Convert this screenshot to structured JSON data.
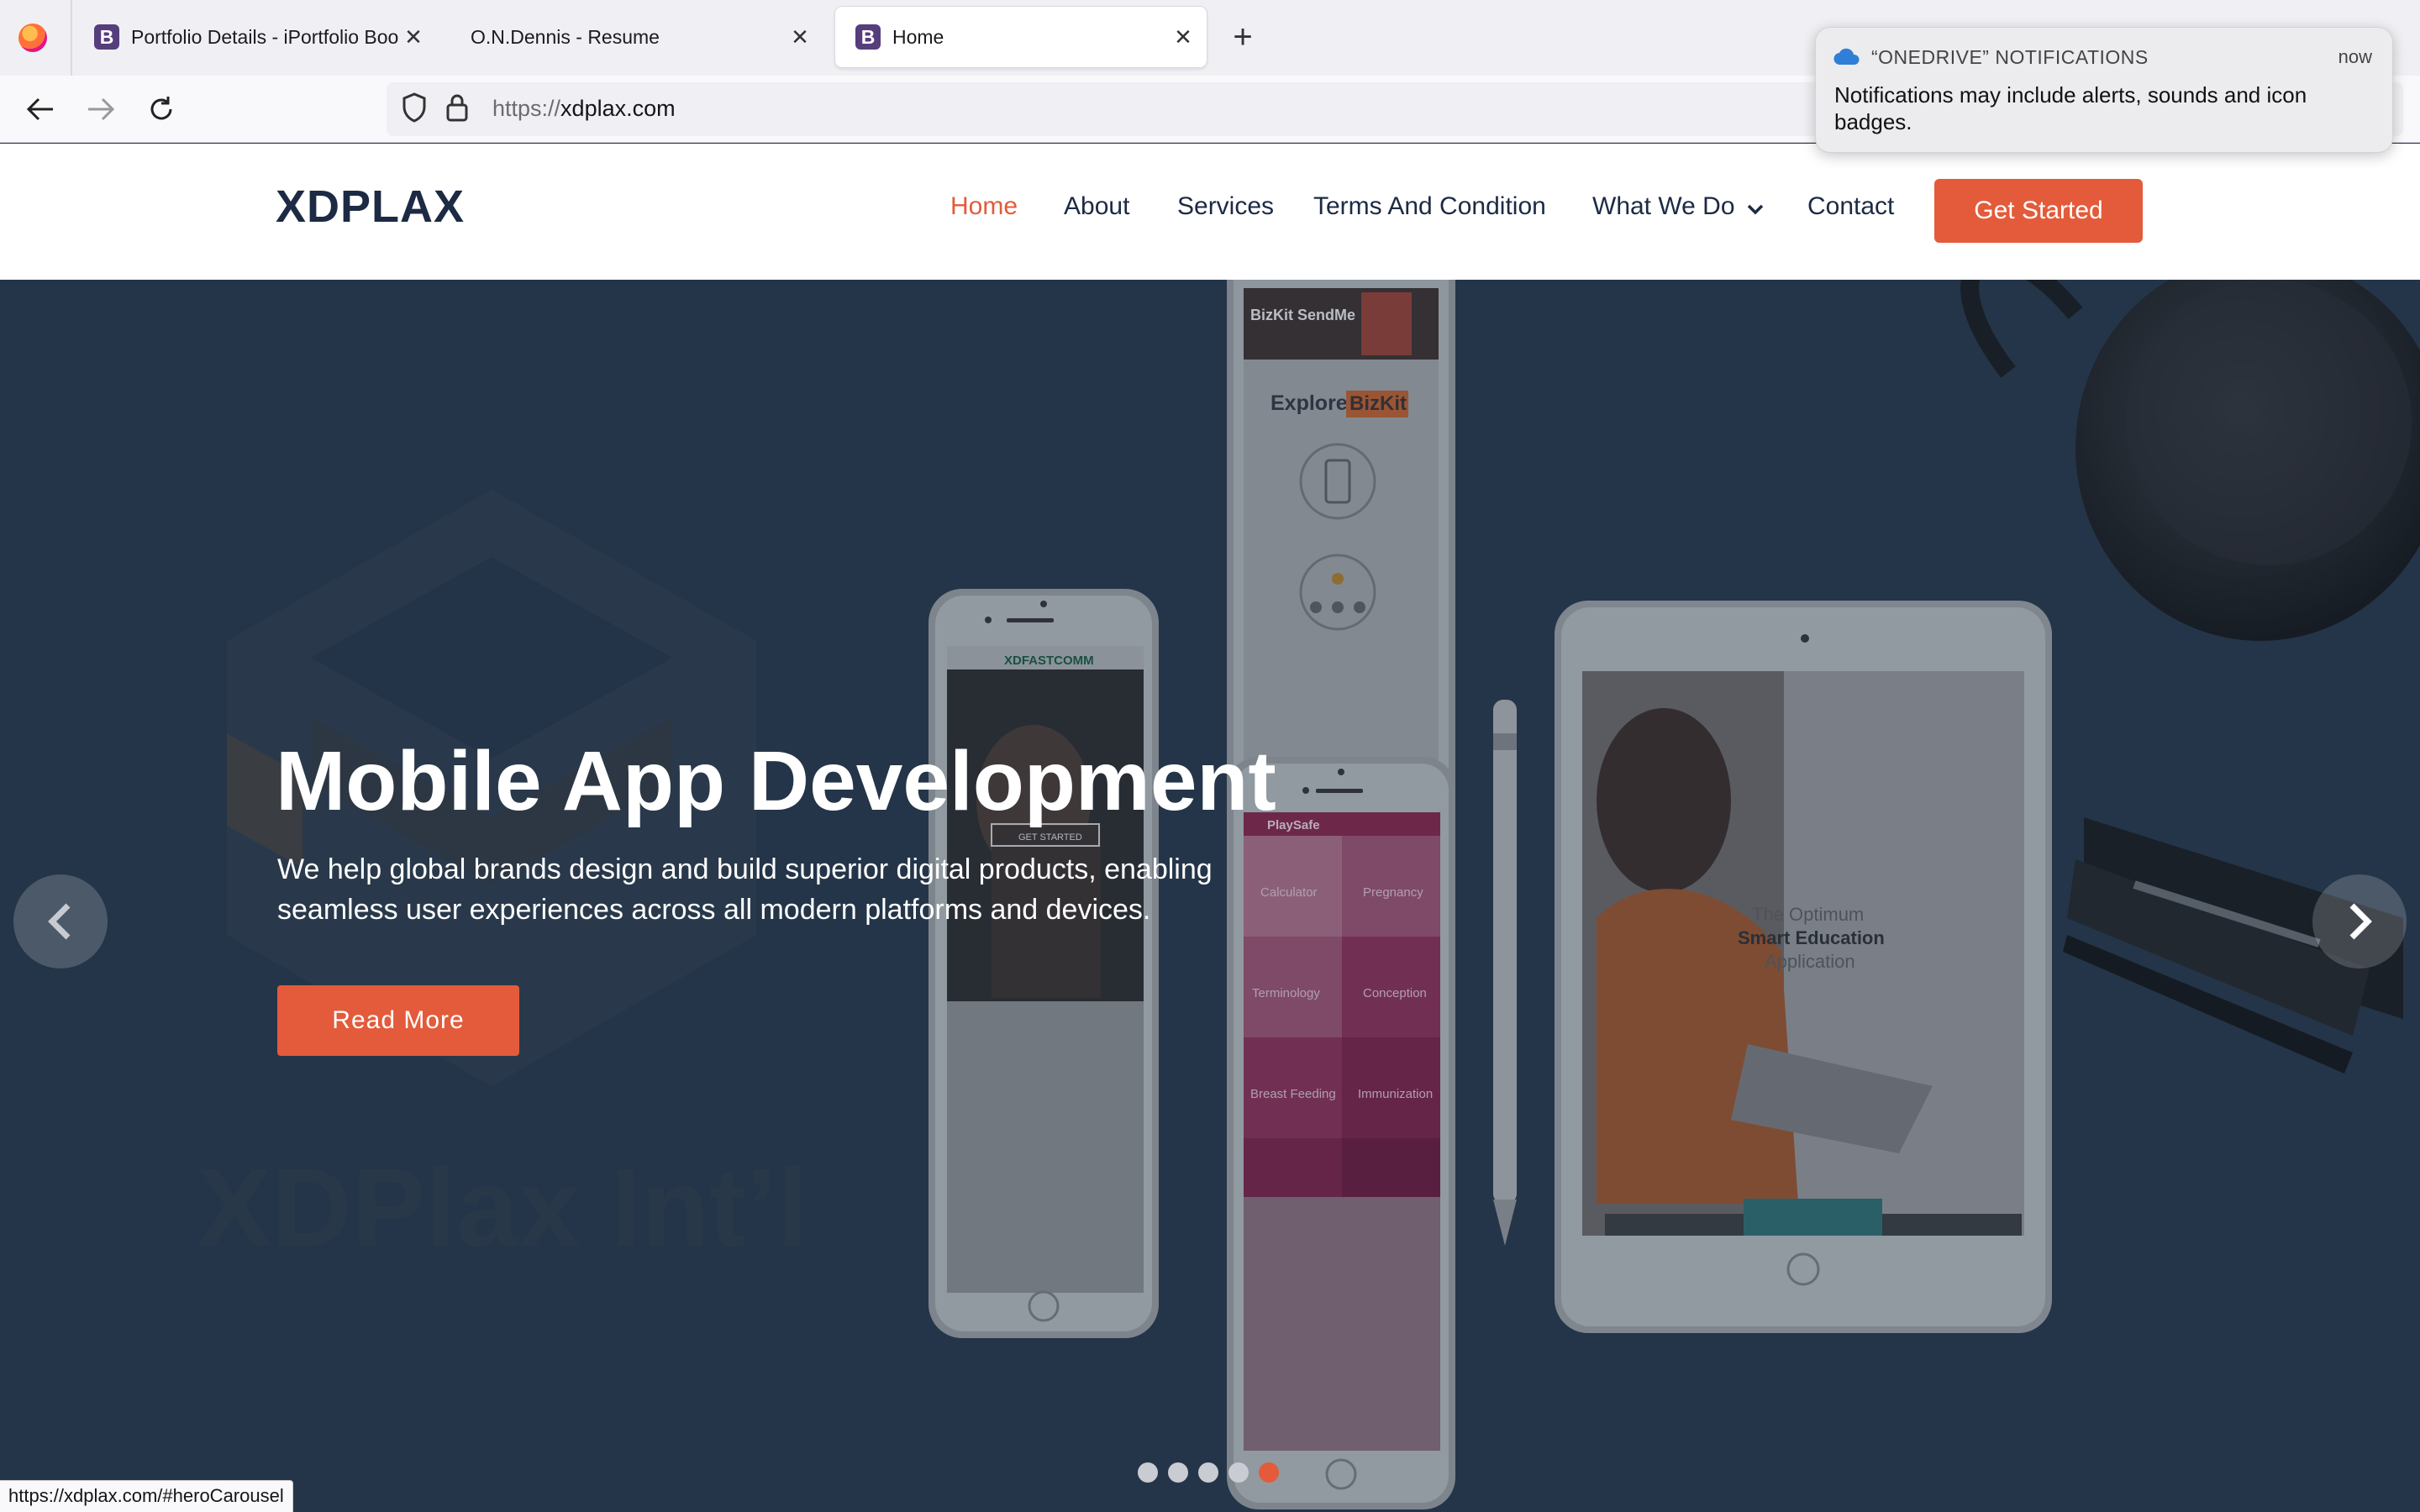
{
  "browser": {
    "tabs": [
      {
        "title": "Portfolio Details - iPortfolio Bootstrap Template",
        "favicon": "B",
        "active": false
      },
      {
        "title": "O.N.Dennis - Resume",
        "favicon": "",
        "active": false
      },
      {
        "title": "Home",
        "favicon": "B",
        "active": true
      }
    ],
    "url_protocol": "https://",
    "url_host": "xdplax.com",
    "status_url": "https://xdplax.com/#heroCarousel"
  },
  "notification": {
    "app": "“ONEDRIVE” NOTIFICATIONS",
    "time": "now",
    "message": "Notifications may include alerts, sounds and icon badges."
  },
  "site": {
    "brand": "XDPLAX",
    "nav": [
      "Home",
      "About",
      "Services",
      "Terms And Condition",
      "What We Do",
      "Contact"
    ],
    "active_nav": "Home",
    "cta": "Get Started",
    "accent": "#e35b3a"
  },
  "hero": {
    "title": "Mobile App Development",
    "subtitle": "We help global brands design and build superior digital products, enabling seamless user experiences across all modern platforms and devices.",
    "button": "Read More",
    "watermark": "XDPlax Int’l",
    "slide_count": 5,
    "active_slide": 5,
    "devices": {
      "phone_top_heading": "Explore",
      "phone_top_highlight": "BizKit",
      "phone_top_banner": "BizKit SendMe",
      "phone_left_brand": "XDFASTCOMM",
      "phone_left_button": "GET STARTED",
      "phone_mid_brand": "PlaySafe",
      "phone_mid_tiles": [
        "Calculator",
        "Pregnancy",
        "Terminology",
        "Conception",
        "Breast Feeding",
        "Immunization"
      ],
      "tablet_line1": "The Optimum",
      "tablet_line2": "Smart Education",
      "tablet_line3": "Application"
    }
  }
}
